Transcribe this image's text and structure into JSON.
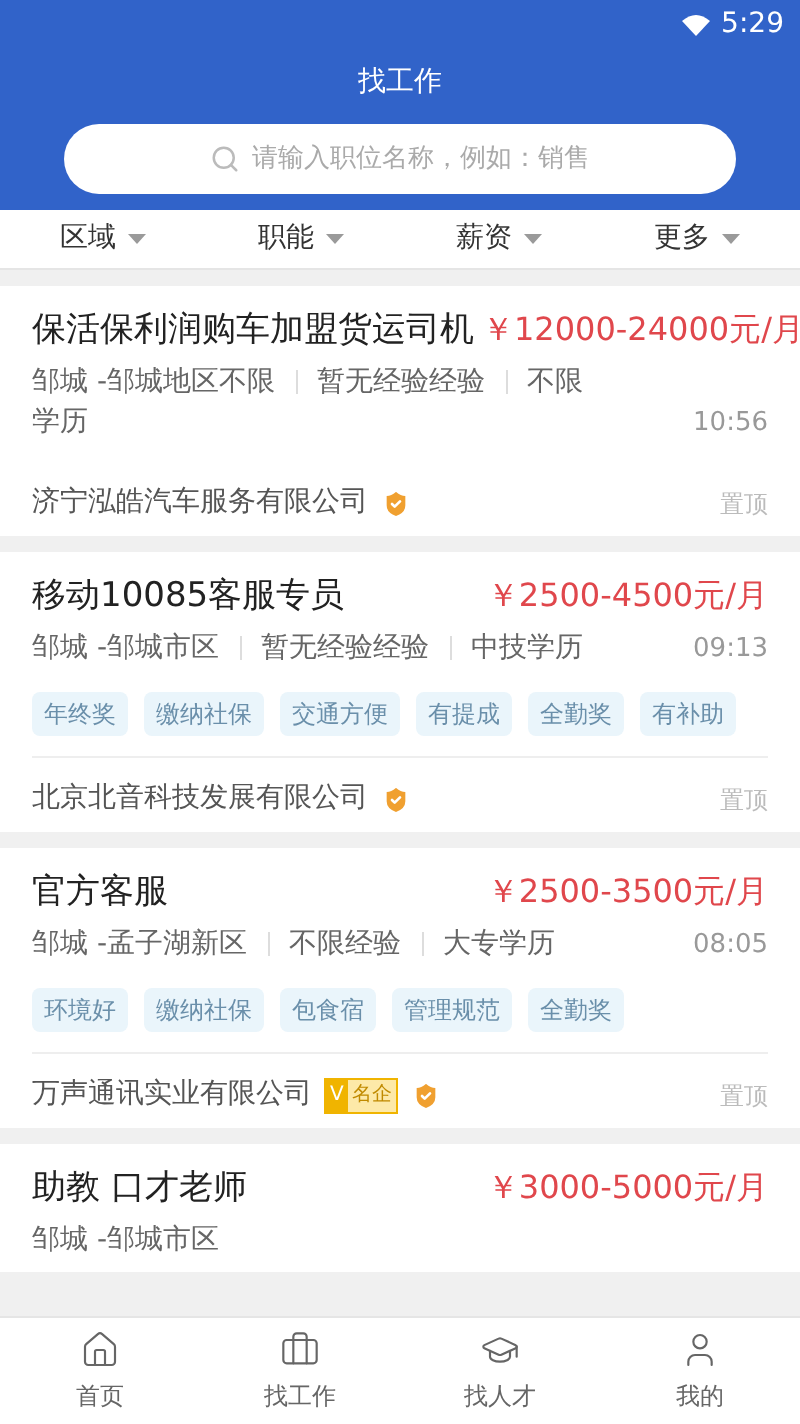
{
  "status_bar": {
    "time": "5:29"
  },
  "header": {
    "title": "找工作"
  },
  "search": {
    "placeholder": "请输入职位名称，例如：销售"
  },
  "filters": [
    {
      "label": "区域"
    },
    {
      "label": "职能"
    },
    {
      "label": "薪资"
    },
    {
      "label": "更多"
    }
  ],
  "jobs": [
    {
      "title": "保活保利润购车加盟货运司机",
      "salary": "￥12000-24000元/月",
      "meta": [
        "邹城 -邹城地区不限",
        "暂无经验经验",
        "不限学历"
      ],
      "time": "10:56",
      "company": "济宁泓皓汽车服务有限公司",
      "famous": false,
      "verified": true,
      "pin": "置顶"
    },
    {
      "title": "移动10085客服专员",
      "salary": "￥2500-4500元/月",
      "meta": [
        "邹城 -邹城市区",
        "暂无经验经验",
        "中技学历"
      ],
      "time": "09:13",
      "tags": [
        "年终奖",
        "缴纳社保",
        "交通方便",
        "有提成",
        "全勤奖",
        "有补助"
      ],
      "company": "北京北音科技发展有限公司",
      "famous": false,
      "verified": true,
      "pin": "置顶"
    },
    {
      "title": "官方客服",
      "salary": "￥2500-3500元/月",
      "meta": [
        "邹城 -孟子湖新区",
        "不限经验",
        "大专学历"
      ],
      "time": "08:05",
      "tags": [
        "环境好",
        "缴纳社保",
        "包食宿",
        "管理规范",
        "全勤奖"
      ],
      "company": "万声通讯实业有限公司",
      "famous": true,
      "famous_mark": "V",
      "famous_label": "名企",
      "verified": true,
      "pin": "置顶"
    },
    {
      "title": "助教 口才老师",
      "salary": "￥3000-5000元/月",
      "meta": [
        "邹城 -邹城市区"
      ]
    }
  ],
  "tab_bar": [
    {
      "label": "首页",
      "selected": false
    },
    {
      "label": "找工作",
      "selected": false
    },
    {
      "label": "找人才",
      "selected": false
    },
    {
      "label": "我的",
      "selected": false
    }
  ]
}
